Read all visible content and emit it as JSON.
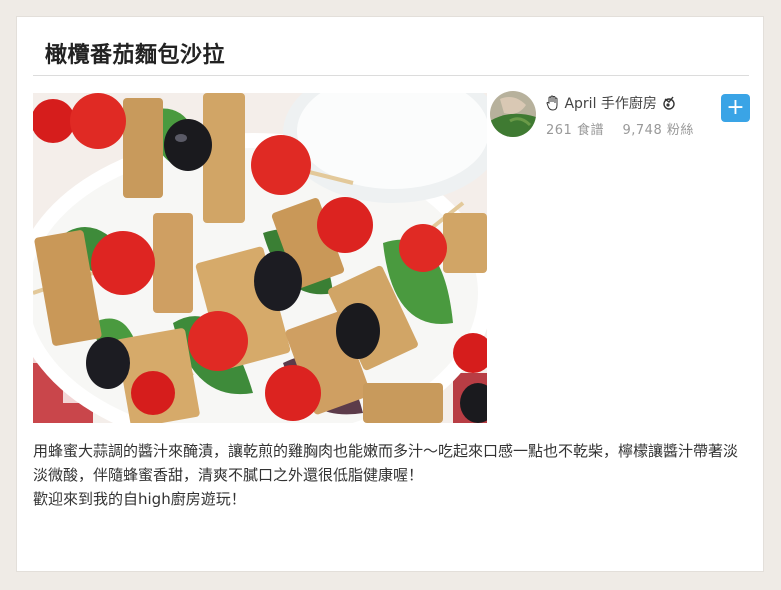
{
  "recipe": {
    "title": "橄欖番茄麵包沙拉",
    "image_alt": "recipe-photo"
  },
  "author": {
    "name": "April 手作廚房",
    "recipes": "261 食譜",
    "fans": "9,748 粉絲",
    "follow_symbol": "+"
  },
  "description": {
    "line1": "用蜂蜜大蒜調的醬汁來醃漬，讓乾煎的雞胸肉也能嫩而多汁～吃起來口感一點也不乾柴，檸檬讓醬汁帶著淡淡微酸，伴隨蜂蜜香甜，清爽不膩口之外還很低脂健康喔！",
    "line2": "歡迎來到我的自high廚房遊玩！"
  },
  "colors": {
    "accent": "#3aa4e6",
    "background": "#efebe6"
  },
  "icons": {
    "hand": "hand-icon",
    "chef": "chef-badge-icon",
    "plus": "plus-icon"
  }
}
